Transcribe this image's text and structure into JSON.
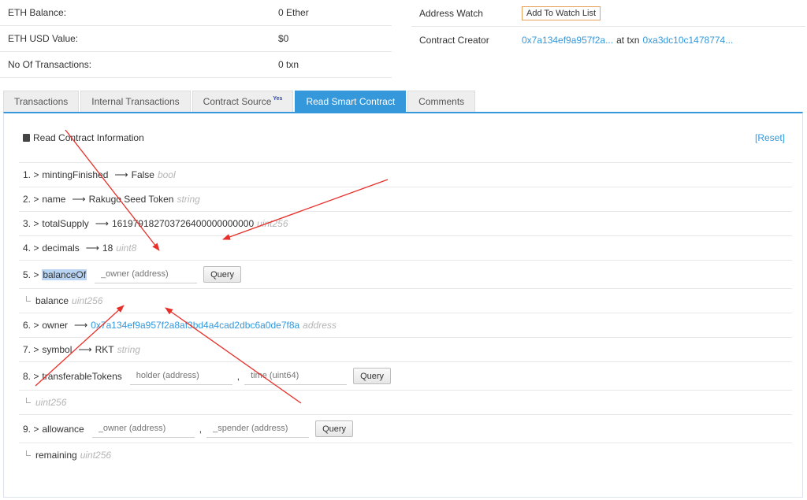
{
  "overview": {
    "eth_balance": {
      "label": "ETH Balance:",
      "value": "0 Ether"
    },
    "eth_usd": {
      "label": "ETH USD Value:",
      "value": "$0"
    },
    "tx_count": {
      "label": "No Of Transactions:",
      "value": "0 txn"
    },
    "address_watch": {
      "label": "Address Watch",
      "button": "Add To Watch List"
    },
    "creator": {
      "label": "Contract Creator",
      "address": "0x7a134ef9a957f2a...",
      "at_txn": "at txn",
      "txn": "0xa3dc10c1478774..."
    }
  },
  "tabs": [
    {
      "label": "Transactions"
    },
    {
      "label": "Internal Transactions"
    },
    {
      "label": "Contract Source",
      "badge": "Yes"
    },
    {
      "label": "Read Smart Contract"
    },
    {
      "label": "Comments"
    }
  ],
  "panel": {
    "title": "Read Contract Information",
    "reset": "[Reset]"
  },
  "functions": {
    "mintingFinished": {
      "num": "1. >",
      "name": "mintingFinished",
      "arrow": "⟶",
      "value": "False",
      "type": "bool"
    },
    "name": {
      "num": "2. >",
      "name": "name",
      "arrow": "⟶",
      "value": "Rakugo Seed Token",
      "type": "string"
    },
    "totalSupply": {
      "num": "3. >",
      "name": "totalSupply",
      "arrow": "⟶",
      "value": "161979182703726400000000000",
      "type": "uint256"
    },
    "decimals": {
      "num": "4. >",
      "name": "decimals",
      "arrow": "⟶",
      "value": "18",
      "type": "uint8"
    },
    "balanceOf": {
      "num": "5. >",
      "name": "balanceOf",
      "placeholder": "_owner (address)",
      "button": "Query",
      "out_name": "balance",
      "out_type": "uint256"
    },
    "owner": {
      "num": "6. >",
      "name": "owner",
      "arrow": "⟶",
      "value": "0x7a134ef9a957f2a8af3bd4a4cad2dbc6a0de7f8a",
      "type": "address"
    },
    "symbol": {
      "num": "7. >",
      "name": "symbol",
      "arrow": "⟶",
      "value": "RKT",
      "type": "string"
    },
    "transferableTokens": {
      "num": "8. >",
      "name": "transferableTokens",
      "placeholder1": "holder (address)",
      "comma": ",",
      "placeholder2": "time (uint64)",
      "button": "Query",
      "out_type": "uint256"
    },
    "allowance": {
      "num": "9. >",
      "name": "allowance",
      "placeholder1": "_owner (address)",
      "comma": ",",
      "placeholder2": "_spender (address)",
      "button": "Query",
      "out_name": "remaining",
      "out_type": "uint256"
    }
  },
  "annotation": {
    "color": "#e8302a"
  }
}
